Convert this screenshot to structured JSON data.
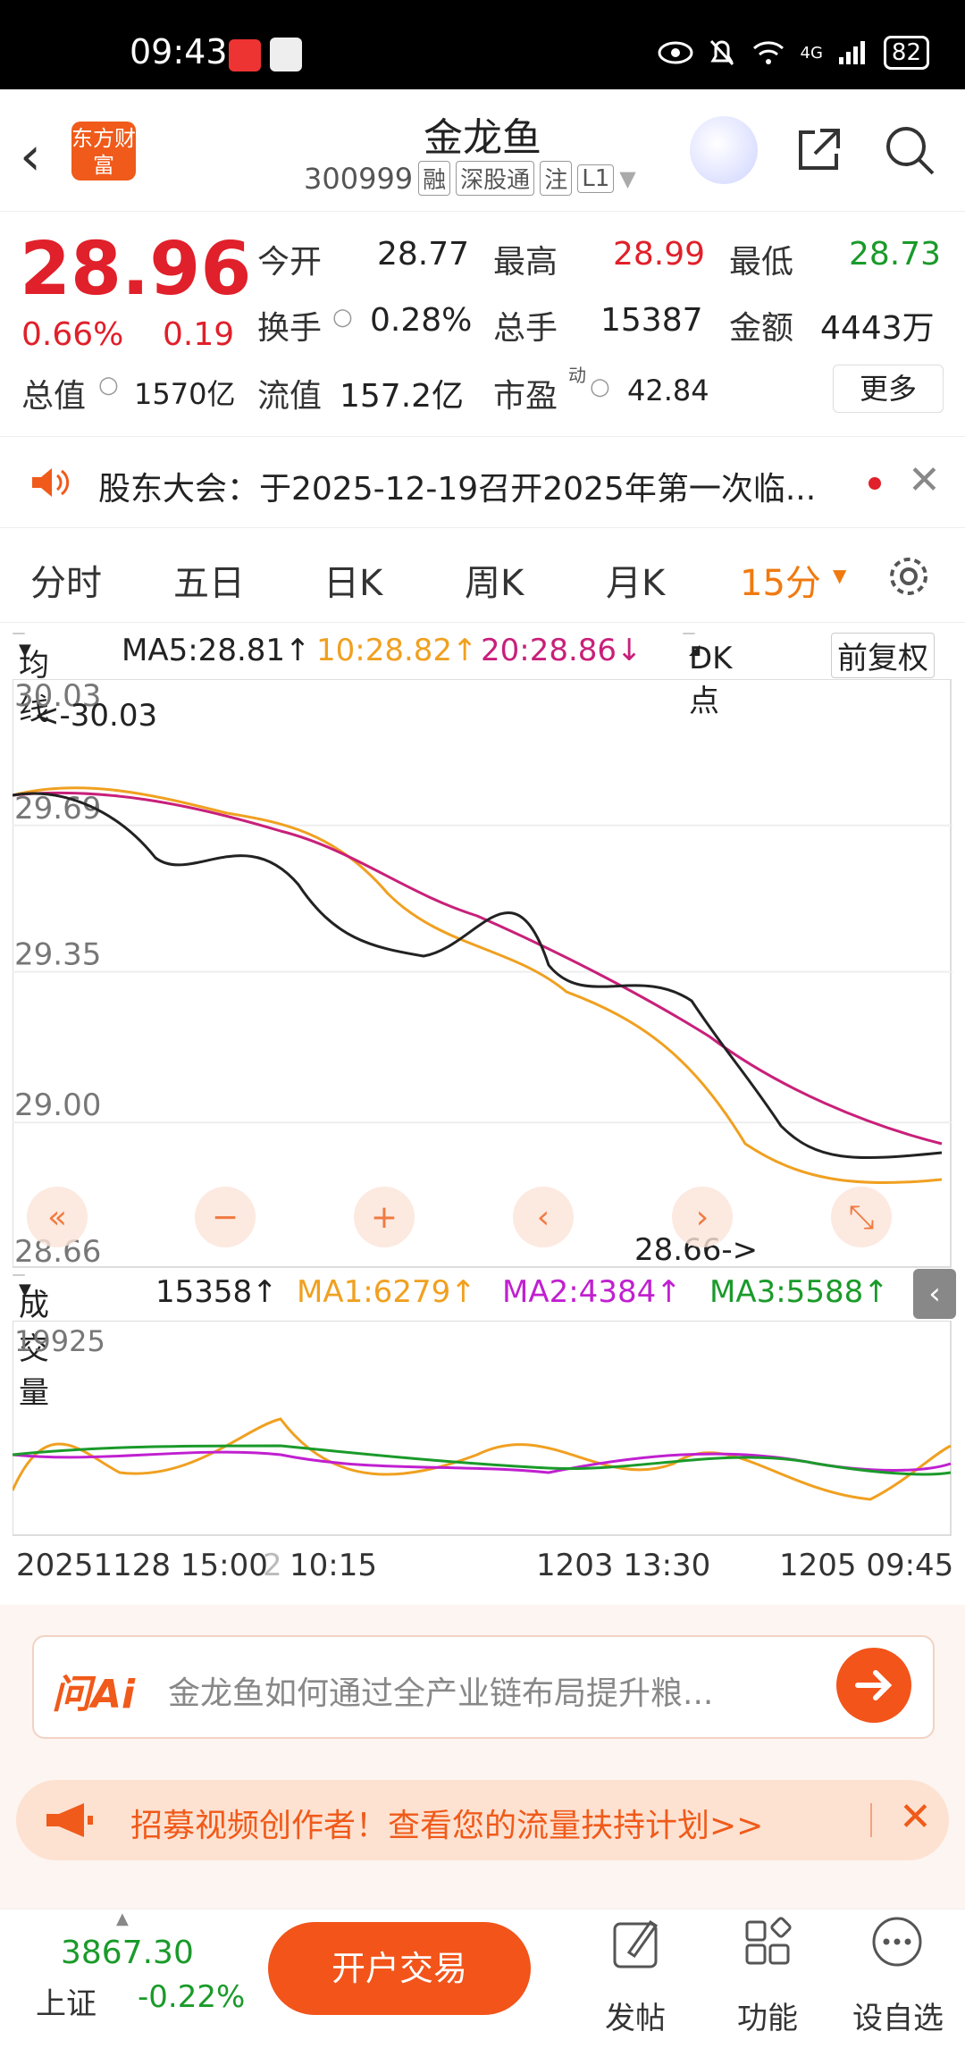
{
  "status_bar": {
    "time": "09:43",
    "network": "4G",
    "battery": "82"
  },
  "header": {
    "logo_text": "东方财富",
    "name": "金龙鱼",
    "code": "300999",
    "tags": [
      "融",
      "深股通",
      "注",
      "L1"
    ]
  },
  "quote": {
    "price": "28.96",
    "change_pct": "0.66%",
    "change": "0.19",
    "open_label": "今开",
    "open": "28.77",
    "high_label": "最高",
    "high": "28.99",
    "low_label": "最低",
    "low": "28.73",
    "turnover_label": "换手",
    "turnover": "0.28%",
    "volume_label": "总手",
    "volume": "15387",
    "amount_label": "金额",
    "amount": "4443万",
    "mktcap_label": "总值",
    "mktcap": "1570亿",
    "float_label": "流值",
    "float": "157.2亿",
    "pe_label": "市盈",
    "pe_sup": "动",
    "pe": "42.84",
    "more": "更多"
  },
  "notice": {
    "text": "股东大会：于2025-12-19召开2025年第一次临..."
  },
  "tabs": [
    {
      "label": "分时"
    },
    {
      "label": "五日"
    },
    {
      "label": "日K"
    },
    {
      "label": "周K"
    },
    {
      "label": "月K"
    },
    {
      "label": "15分"
    }
  ],
  "ma_bar": {
    "ma_select": "均线",
    "ma5": "MA5:28.81↑",
    "ma10": "10:28.82↑",
    "ma20": "20:28.86↓",
    "dk": "DK点",
    "adjust": "前复权"
  },
  "chart_data": {
    "type": "candlestick",
    "y_ticks": [
      "30.03",
      "29.69",
      "29.35",
      "29.00",
      "28.66"
    ],
    "ylim": [
      28.66,
      30.03
    ],
    "high_annotation": "<-30.03",
    "low_annotation": "28.66->",
    "x_ticks": [
      "20251128 15:00",
      "2",
      "10:15",
      "1203 13:30",
      "1205 09:45"
    ],
    "volume_ymax": "19925"
  },
  "vol_bar": {
    "select": "成交量",
    "value": "15358↑",
    "ma1": "MA1:6279↑",
    "ma2": "MA2:4384↑",
    "ma3": "MA3:5588↑"
  },
  "colors": {
    "up": "#e0202a",
    "down": "#1a9a2a",
    "ma5": "#222222",
    "ma10": "#f0a020",
    "ma20": "#c8207a",
    "accent": "#f2541a"
  },
  "ai_box": {
    "logo": "问Ai",
    "question": "金龙鱼如何通过全产业链布局提升粮..."
  },
  "recruit": {
    "text": "招募视频创作者！查看您的流量扶持计划>>"
  },
  "bottom": {
    "index_value": "3867.30",
    "index_name": "上证",
    "index_change": "-0.22%",
    "open_account": "开户交易",
    "post": "发帖",
    "func": "功能",
    "watch": "设自选"
  }
}
